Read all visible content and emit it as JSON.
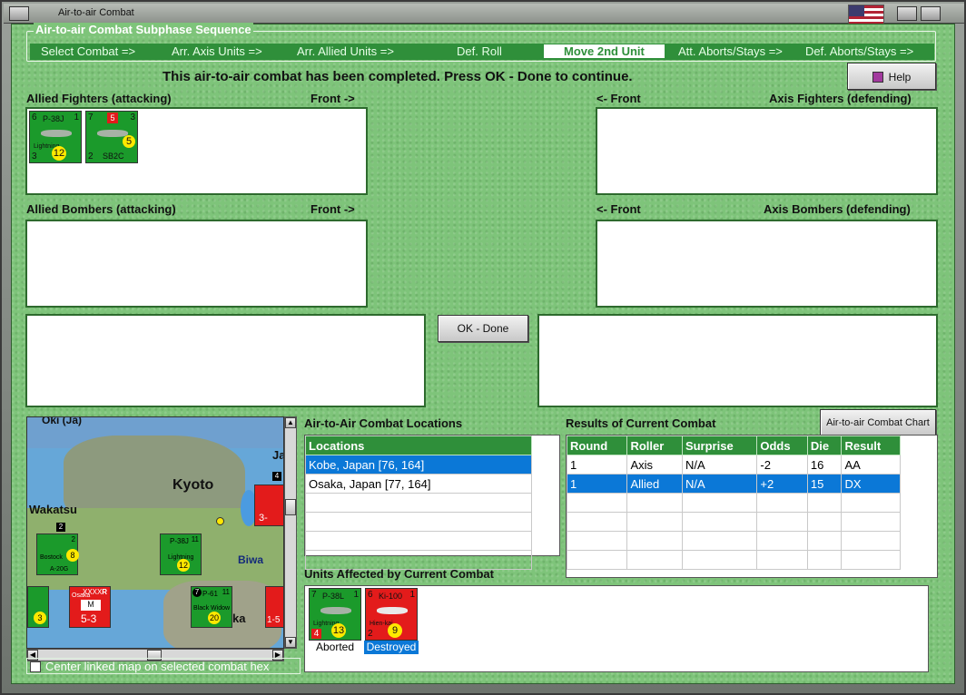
{
  "window": {
    "title": "Air-to-air Combat"
  },
  "sequence": {
    "title": "Air-to-air Combat Subphase Sequence",
    "steps": [
      "Select Combat =>",
      "Arr. Axis Units =>",
      "Arr. Allied Units =>",
      "Def. Roll",
      "Move 2nd Unit",
      "Att. Aborts/Stays =>",
      "Def. Aborts/Stays =>"
    ],
    "active_index": 4
  },
  "status_message": "This air-to-air combat has been completed.  Press OK - Done to continue.",
  "help_label": "Help",
  "panels": {
    "allied_fighters": "Allied Fighters (attacking)",
    "axis_fighters": "Axis Fighters (defending)",
    "allied_bombers": "Allied Bombers (attacking)",
    "axis_bombers": "Axis Bombers (defending)",
    "front_right": "Front ->",
    "front_left": "<- Front"
  },
  "allied_fighter_counters": [
    {
      "tl": "6",
      "name": "P-38J",
      "tr": "1",
      "bl": "3",
      "sub": "Lightning",
      "dot": "12",
      "color": "green"
    },
    {
      "tl": "7",
      "flag": "5",
      "tr": "3",
      "bl": "2",
      "sub": "SB2C",
      "dot": "5",
      "color": "green"
    }
  ],
  "ok_done_label": "OK - Done",
  "locations": {
    "title": "Air-to-Air Combat Locations",
    "header": "Locations",
    "rows": [
      "Kobe, Japan [76, 164]",
      "Osaka, Japan [77, 164]",
      "",
      "",
      "",
      ""
    ],
    "selected_index": 0
  },
  "results": {
    "title": "Results of Current Combat",
    "chart_button": "Air-to-air Combat Chart",
    "columns": [
      "Round",
      "Roller",
      "Surprise",
      "Odds",
      "Die",
      "Result"
    ],
    "rows": [
      [
        "1",
        "Axis",
        "N/A",
        "-2",
        "16",
        "AA"
      ],
      [
        "1",
        "Allied",
        "N/A",
        "+2",
        "15",
        "DX"
      ],
      [
        "",
        "",
        "",
        "",
        "",
        ""
      ],
      [
        "",
        "",
        "",
        "",
        "",
        ""
      ],
      [
        "",
        "",
        "",
        "",
        "",
        ""
      ],
      [
        "",
        "",
        "",
        "",
        "",
        ""
      ]
    ],
    "selected_index": 1
  },
  "affected": {
    "title": "Units Affected by Current Combat",
    "units": [
      {
        "tl": "7",
        "name": "P-38L",
        "tr": "1",
        "bl": "4",
        "sub": "Lightning",
        "dot": "13",
        "color": "green",
        "status": "Aborted"
      },
      {
        "tl": "6",
        "name": "Ki-100",
        "tr": "1",
        "bl": "2",
        "sub": "Hien-kai",
        "dot": "9",
        "color": "red",
        "status": "Destroyed"
      }
    ]
  },
  "map": {
    "labels": [
      "Oki (Ja)",
      "Kyoto",
      "Wakatsu",
      "Biwa",
      "Ja",
      "ka"
    ],
    "counters": [
      {
        "top": "2",
        "name": "Bostock",
        "sub": "A-20G",
        "dot": "8"
      },
      {
        "top": "11",
        "name": "P-38J",
        "sub": "Lightning",
        "dot": "12"
      },
      {
        "top": "11",
        "name": "P-61",
        "sub": "Black Widow",
        "dot": "20"
      }
    ],
    "red_counter": {
      "name": "Osaka",
      "letter": "M",
      "value": "5-3",
      "tag": "R",
      "top": "XXXX"
    },
    "edge_values": [
      "3-",
      "1-5",
      "3",
      "2",
      "4",
      "7"
    ]
  },
  "center_checkbox_label": "Center linked map on selected combat hex"
}
